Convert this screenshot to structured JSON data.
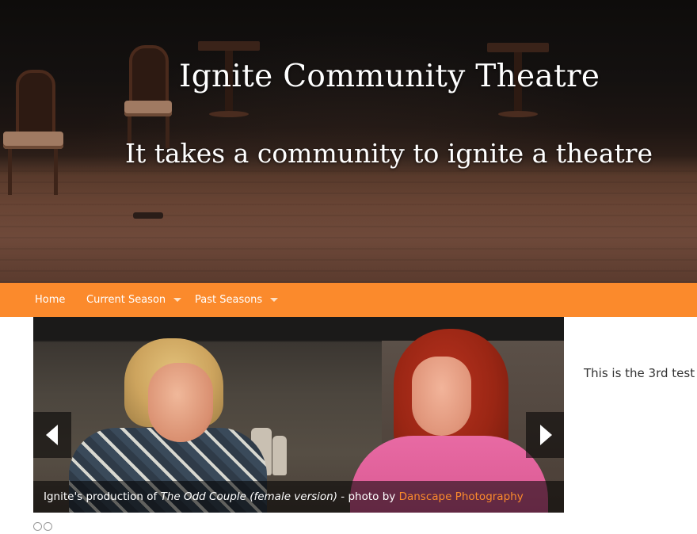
{
  "header": {
    "site_title": "Ignite Community Theatre",
    "tagline": "It takes a community to ignite a theatre"
  },
  "nav": {
    "items": [
      {
        "label": "Home",
        "has_dropdown": false
      },
      {
        "label": "Current Season",
        "has_dropdown": true
      },
      {
        "label": "Past Seasons",
        "has_dropdown": true
      }
    ]
  },
  "slider": {
    "caption": {
      "prefix": "Ignite's production of ",
      "show_title": "The Odd Couple (female version)",
      "middle": " - photo by ",
      "credit_link": "Danscape Photography"
    },
    "prev_icon": "chevron-left-icon",
    "next_icon": "chevron-right-icon"
  },
  "sidebar": {
    "text": "This is the 3rd test"
  },
  "colors": {
    "nav_background": "#fb8a2c",
    "link_accent": "#fb8a2c",
    "header_text": "#ffffff"
  }
}
